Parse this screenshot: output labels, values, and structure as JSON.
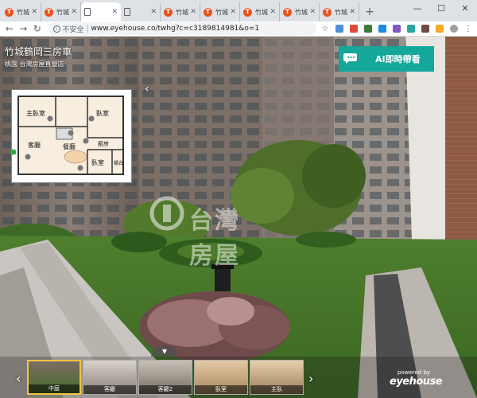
{
  "browser": {
    "tabs": [
      {
        "title": "竹城",
        "favicon": "T-logo"
      },
      {
        "title": "竹城",
        "favicon": "T-logo"
      },
      {
        "title": "",
        "favicon": "doc",
        "active": true
      },
      {
        "title": "",
        "favicon": "doc"
      },
      {
        "title": "竹城",
        "favicon": "T-logo"
      },
      {
        "title": "竹城",
        "favicon": "T-logo"
      },
      {
        "title": "竹城",
        "favicon": "T-logo"
      },
      {
        "title": "竹城",
        "favicon": "T-logo"
      },
      {
        "title": "竹城",
        "favicon": "T-logo"
      }
    ],
    "new_tab": "+",
    "security_label": "不安全",
    "url": "www.eyehouse.co/twhg?c=c3189814981&o=1"
  },
  "listing": {
    "title": "竹城鶴岡三房車",
    "subtitle": "桃園 台灣房屋直營店"
  },
  "ai_button": {
    "label": "AI即時帶看"
  },
  "floorplan": {
    "rooms": [
      "主臥室",
      "臥室",
      "廚房",
      "客廳",
      "餐廳",
      "臥室",
      "陽台"
    ]
  },
  "watermark": {
    "text": "台灣房屋"
  },
  "thumbnails": [
    {
      "label": "中庭",
      "active": true
    },
    {
      "label": "客廳"
    },
    {
      "label": "客廳2"
    },
    {
      "label": "臥室"
    },
    {
      "label": "主臥"
    }
  ],
  "branding": {
    "powered_by": "powered by",
    "name": "eyehouse"
  },
  "colors": {
    "accent": "#14a79a",
    "tab_favicon": "#e8531c",
    "active_thumb": "#f4c542"
  }
}
